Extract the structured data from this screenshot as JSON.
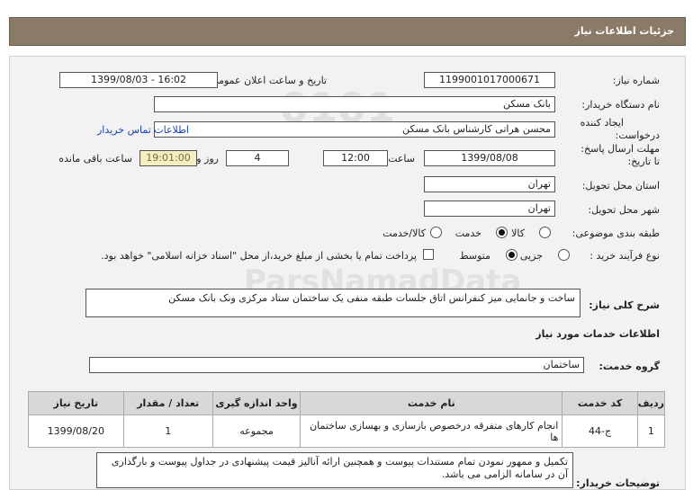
{
  "page": {
    "title": "جزئیات اطلاعات نیاز"
  },
  "fields": {
    "need_number": {
      "label": "شماره نیاز:",
      "value": "1199001017000671"
    },
    "announce_datetime": {
      "label": "تاریخ و ساعت اعلان عمومی:",
      "value": "1399/08/03 - 16:02"
    },
    "buyer_org": {
      "label": "نام دستگاه خریدار:",
      "value": "بانک مسکن"
    },
    "requester": {
      "label_line1": "ایجاد کننده",
      "label_line2": "درخواست:",
      "value": "محسن  هراتی  کارشناس بانک مسکن"
    },
    "contact_link": "اطلاعات تماس خریدار",
    "deadline": {
      "label_line1": "مهلت ارسال پاسخ:",
      "label_line2": "تا تاریخ:",
      "date": "1399/08/08",
      "time_label": "ساعت",
      "time": "12:00",
      "days": "4",
      "days_label": "روز و",
      "remaining_time": "19:01:00",
      "remaining_label": "ساعت باقی مانده"
    },
    "province": {
      "label": "استان محل تحویل:",
      "value": "تهران"
    },
    "city": {
      "label": "شهر محل تحویل:",
      "value": "تهران"
    },
    "category": {
      "label": "طبقه بندی موضوعی:",
      "options": [
        "کالا",
        "خدمت",
        "کالا/خدمت"
      ],
      "selected": "خدمت"
    },
    "process_type": {
      "label": "نوع فرآیند خرید :",
      "options": [
        "جزیی",
        "متوسط"
      ],
      "selected": "متوسط",
      "payment_note": "پرداخت تمام یا بخشی از مبلغ خرید،از محل \"اسناد خزانه اسلامی\" خواهد بود."
    }
  },
  "summary": {
    "label": "شرح کلی نیاز:",
    "value": "ساخت و جانمایی میز کنفرانس اتاق جلسات طبقه منفی یک ساختمان ستاد مرکزی ونک بانک مسکن"
  },
  "services_section": {
    "title": "اطلاعات خدمات مورد نیاز"
  },
  "service_group": {
    "label": "گروه خدمت:",
    "value": "ساختمان"
  },
  "table": {
    "headers": [
      "ردیف",
      "کد خدمت",
      "نام خدمت",
      "واحد اندازه گیری",
      "تعداد / مقدار",
      "تاریخ نیاز"
    ],
    "rows": [
      {
        "index": "1",
        "code": "ج-44",
        "name": "انجام کارهای متفرقه درخصوص بازسازی و بهسازی ساختمان ها",
        "unit": "مجموعه",
        "qty": "1",
        "date": "1399/08/20"
      }
    ]
  },
  "buyer_notes": {
    "label": "توضیحات خریدار:",
    "value": "تکمیل و ممهور نمودن تمام مستندات پیوست و همچنین ارائه آنالیز قیمت پیشنهادی در جداول پیوست و بارگذاری آن در سامانه الزامی می باشد."
  }
}
